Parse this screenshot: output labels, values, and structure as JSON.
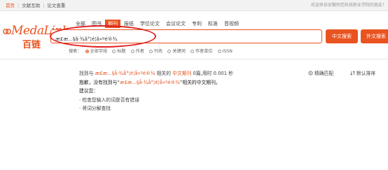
{
  "topbar": {
    "links": [
      "首页",
      "文献互助",
      "论文查重"
    ],
    "notice": "欢迎来自安徽师范科技职业学院的朋友！"
  },
  "logo": {
    "brand": "MedaLink",
    "brand_cn": "百链"
  },
  "tabs": [
    "全部",
    "图书",
    "期刊",
    "报纸",
    "学位论文",
    "会议论文",
    "专利",
    "标准",
    "音视频"
  ],
  "active_tab_index": 2,
  "search": {
    "value": "æ­£æ...§å·¾å°¦é¦å»ºé®¾",
    "btn_cn": "中文搜索",
    "btn_foreign": "外文搜索"
  },
  "filters": {
    "label": "搜索：",
    "options": [
      "全部字段",
      "标题",
      "作者",
      "刊名",
      "关键词",
      "作者单位",
      "ISSN"
    ],
    "selected_index": 0
  },
  "result": {
    "prefix": "找到与",
    "query": "æ­£æ...§å·¾å°¦é¦å»ºé®¾",
    "mid": "相关的",
    "type": "中文期刊",
    "count": "0",
    "suffix": "篇,用时 0.001 秒",
    "sorry_prefix": "抱歉，没有找到与“",
    "sorry_query": "æ­£æ...§å·¾å°¦é¦å»ºé®¾",
    "sorry_suffix": "”相关的中文期刊。",
    "suggest_title": "建议您：",
    "suggest_1": "· 检查您输入的词是否有错误",
    "suggest_2": "· 将词分解查找"
  },
  "sort": {
    "match": "精确匹配",
    "order": "默认排序"
  },
  "colors": {
    "accent": "#e9531f",
    "highlight_oval": "#e02020"
  }
}
